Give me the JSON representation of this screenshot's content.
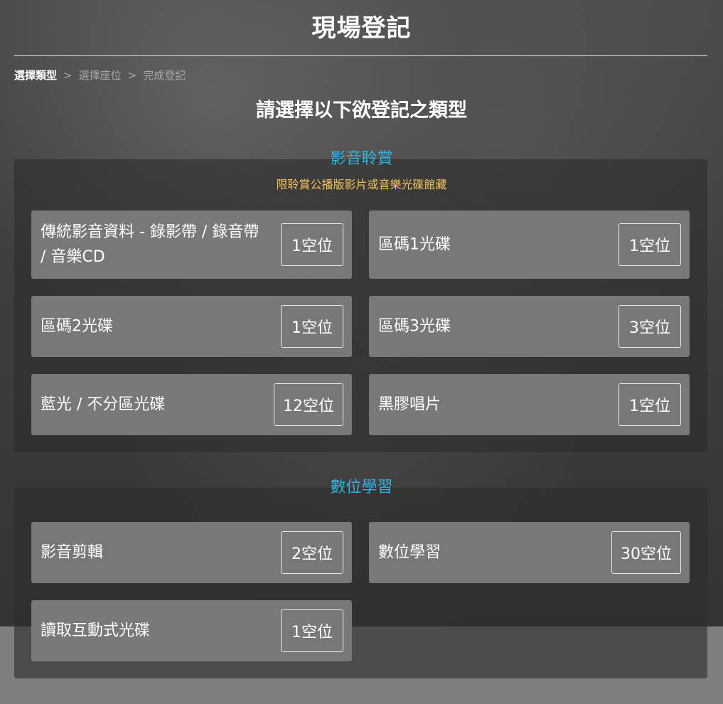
{
  "header": {
    "title": "現場登記"
  },
  "breadcrumb": {
    "steps": [
      "選擇類型",
      "選擇座位",
      "完成登記"
    ],
    "separator": ">"
  },
  "subtitle": "請選擇以下欲登記之類型",
  "sections": [
    {
      "title": "影音聆賞",
      "note": "限聆賞公播版影片或音樂光碟館藏",
      "cards": [
        {
          "label": "傳統影音資料 - 錄影帶 / 錄音帶 / 音樂CD",
          "seats": "1空位"
        },
        {
          "label": "區碼1光碟",
          "seats": "1空位"
        },
        {
          "label": "區碼2光碟",
          "seats": "1空位"
        },
        {
          "label": "區碼3光碟",
          "seats": "3空位"
        },
        {
          "label": "藍光 / 不分區光碟",
          "seats": "12空位"
        },
        {
          "label": "黑膠唱片",
          "seats": "1空位"
        }
      ]
    },
    {
      "title": "數位學習",
      "cards": [
        {
          "label": "影音剪輯",
          "seats": "2空位"
        },
        {
          "label": "數位學習",
          "seats": "30空位"
        },
        {
          "label": "讀取互動式光碟",
          "seats": "1空位"
        }
      ]
    }
  ],
  "colors": {
    "section_title": "#2eb2e0",
    "note": "#f3c35b",
    "card_bg": "#787878"
  }
}
